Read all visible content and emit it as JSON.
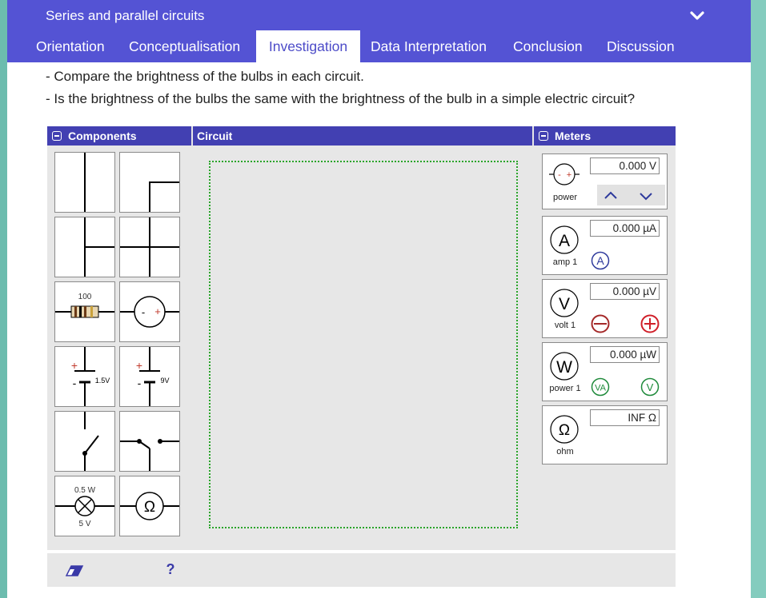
{
  "window": {
    "title": "Series and parallel circuits"
  },
  "tabs": [
    {
      "label": "Orientation",
      "active": false
    },
    {
      "label": "Conceptualisation",
      "active": false
    },
    {
      "label": "Investigation",
      "active": true
    },
    {
      "label": "Data Interpretation",
      "active": false
    },
    {
      "label": "Conclusion",
      "active": false
    },
    {
      "label": "Discussion",
      "active": false
    }
  ],
  "instructions": [
    "- Compare the brightness of the bulbs in each circuit.",
    "- Is the brightness of the bulbs the same with the brightness of the bulb in a simple electric circuit?"
  ],
  "panels": {
    "components": "Components",
    "circuit": "Circuit",
    "meters": "Meters"
  },
  "components": [
    {
      "name": "straight-wire"
    },
    {
      "name": "corner-wire"
    },
    {
      "name": "t-junction-wire"
    },
    {
      "name": "cross-junction-wire"
    },
    {
      "name": "resistor",
      "label": "100"
    },
    {
      "name": "power-source",
      "minus": "-",
      "plus": "+"
    },
    {
      "name": "battery-1-5v",
      "plus": "+",
      "minus": "-",
      "label": "1.5V"
    },
    {
      "name": "battery-9v",
      "plus": "+",
      "minus": "-",
      "label": "9V"
    },
    {
      "name": "switch"
    },
    {
      "name": "two-way-switch"
    },
    {
      "name": "bulb",
      "power": "0.5 W",
      "voltage": "5 V"
    },
    {
      "name": "ohmmeter",
      "symbol": "Ω"
    }
  ],
  "meters": {
    "power": {
      "label": "power",
      "value": "0.000 V"
    },
    "amp": {
      "label": "amp 1",
      "symbol": "A",
      "value": "0.000 µA",
      "button": "A"
    },
    "volt": {
      "label": "volt 1",
      "symbol": "V",
      "value": "0.000 µV"
    },
    "watt": {
      "label": "power 1",
      "symbol": "W",
      "value": "0.000 µW",
      "va": "VA",
      "v": "V"
    },
    "ohm": {
      "label": "ohm",
      "symbol": "Ω",
      "value": "INF Ω"
    }
  },
  "toolbar": {
    "help": "?"
  },
  "colors": {
    "header": "#5453d4",
    "panel_header": "#4240b2",
    "accent_green": "#2aa52a",
    "red": "#c0392b",
    "blue": "#2e3a9c"
  }
}
